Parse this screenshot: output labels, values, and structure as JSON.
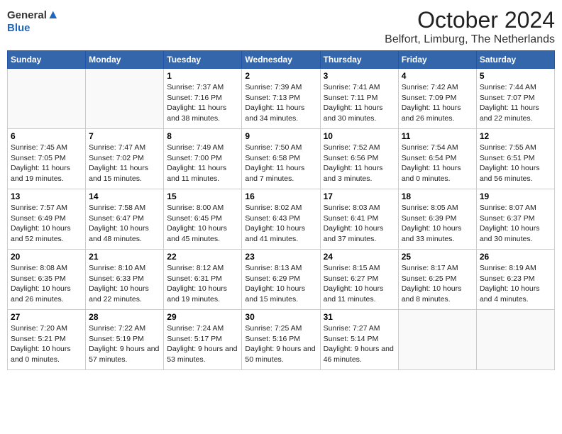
{
  "logo": {
    "general": "General",
    "blue": "Blue"
  },
  "title": "October 2024",
  "location": "Belfort, Limburg, The Netherlands",
  "weekdays": [
    "Sunday",
    "Monday",
    "Tuesday",
    "Wednesday",
    "Thursday",
    "Friday",
    "Saturday"
  ],
  "weeks": [
    [
      {
        "day": "",
        "sunrise": "",
        "sunset": "",
        "daylight": ""
      },
      {
        "day": "",
        "sunrise": "",
        "sunset": "",
        "daylight": ""
      },
      {
        "day": "1",
        "sunrise": "Sunrise: 7:37 AM",
        "sunset": "Sunset: 7:16 PM",
        "daylight": "Daylight: 11 hours and 38 minutes."
      },
      {
        "day": "2",
        "sunrise": "Sunrise: 7:39 AM",
        "sunset": "Sunset: 7:13 PM",
        "daylight": "Daylight: 11 hours and 34 minutes."
      },
      {
        "day": "3",
        "sunrise": "Sunrise: 7:41 AM",
        "sunset": "Sunset: 7:11 PM",
        "daylight": "Daylight: 11 hours and 30 minutes."
      },
      {
        "day": "4",
        "sunrise": "Sunrise: 7:42 AM",
        "sunset": "Sunset: 7:09 PM",
        "daylight": "Daylight: 11 hours and 26 minutes."
      },
      {
        "day": "5",
        "sunrise": "Sunrise: 7:44 AM",
        "sunset": "Sunset: 7:07 PM",
        "daylight": "Daylight: 11 hours and 22 minutes."
      }
    ],
    [
      {
        "day": "6",
        "sunrise": "Sunrise: 7:45 AM",
        "sunset": "Sunset: 7:05 PM",
        "daylight": "Daylight: 11 hours and 19 minutes."
      },
      {
        "day": "7",
        "sunrise": "Sunrise: 7:47 AM",
        "sunset": "Sunset: 7:02 PM",
        "daylight": "Daylight: 11 hours and 15 minutes."
      },
      {
        "day": "8",
        "sunrise": "Sunrise: 7:49 AM",
        "sunset": "Sunset: 7:00 PM",
        "daylight": "Daylight: 11 hours and 11 minutes."
      },
      {
        "day": "9",
        "sunrise": "Sunrise: 7:50 AM",
        "sunset": "Sunset: 6:58 PM",
        "daylight": "Daylight: 11 hours and 7 minutes."
      },
      {
        "day": "10",
        "sunrise": "Sunrise: 7:52 AM",
        "sunset": "Sunset: 6:56 PM",
        "daylight": "Daylight: 11 hours and 3 minutes."
      },
      {
        "day": "11",
        "sunrise": "Sunrise: 7:54 AM",
        "sunset": "Sunset: 6:54 PM",
        "daylight": "Daylight: 11 hours and 0 minutes."
      },
      {
        "day": "12",
        "sunrise": "Sunrise: 7:55 AM",
        "sunset": "Sunset: 6:51 PM",
        "daylight": "Daylight: 10 hours and 56 minutes."
      }
    ],
    [
      {
        "day": "13",
        "sunrise": "Sunrise: 7:57 AM",
        "sunset": "Sunset: 6:49 PM",
        "daylight": "Daylight: 10 hours and 52 minutes."
      },
      {
        "day": "14",
        "sunrise": "Sunrise: 7:58 AM",
        "sunset": "Sunset: 6:47 PM",
        "daylight": "Daylight: 10 hours and 48 minutes."
      },
      {
        "day": "15",
        "sunrise": "Sunrise: 8:00 AM",
        "sunset": "Sunset: 6:45 PM",
        "daylight": "Daylight: 10 hours and 45 minutes."
      },
      {
        "day": "16",
        "sunrise": "Sunrise: 8:02 AM",
        "sunset": "Sunset: 6:43 PM",
        "daylight": "Daylight: 10 hours and 41 minutes."
      },
      {
        "day": "17",
        "sunrise": "Sunrise: 8:03 AM",
        "sunset": "Sunset: 6:41 PM",
        "daylight": "Daylight: 10 hours and 37 minutes."
      },
      {
        "day": "18",
        "sunrise": "Sunrise: 8:05 AM",
        "sunset": "Sunset: 6:39 PM",
        "daylight": "Daylight: 10 hours and 33 minutes."
      },
      {
        "day": "19",
        "sunrise": "Sunrise: 8:07 AM",
        "sunset": "Sunset: 6:37 PM",
        "daylight": "Daylight: 10 hours and 30 minutes."
      }
    ],
    [
      {
        "day": "20",
        "sunrise": "Sunrise: 8:08 AM",
        "sunset": "Sunset: 6:35 PM",
        "daylight": "Daylight: 10 hours and 26 minutes."
      },
      {
        "day": "21",
        "sunrise": "Sunrise: 8:10 AM",
        "sunset": "Sunset: 6:33 PM",
        "daylight": "Daylight: 10 hours and 22 minutes."
      },
      {
        "day": "22",
        "sunrise": "Sunrise: 8:12 AM",
        "sunset": "Sunset: 6:31 PM",
        "daylight": "Daylight: 10 hours and 19 minutes."
      },
      {
        "day": "23",
        "sunrise": "Sunrise: 8:13 AM",
        "sunset": "Sunset: 6:29 PM",
        "daylight": "Daylight: 10 hours and 15 minutes."
      },
      {
        "day": "24",
        "sunrise": "Sunrise: 8:15 AM",
        "sunset": "Sunset: 6:27 PM",
        "daylight": "Daylight: 10 hours and 11 minutes."
      },
      {
        "day": "25",
        "sunrise": "Sunrise: 8:17 AM",
        "sunset": "Sunset: 6:25 PM",
        "daylight": "Daylight: 10 hours and 8 minutes."
      },
      {
        "day": "26",
        "sunrise": "Sunrise: 8:19 AM",
        "sunset": "Sunset: 6:23 PM",
        "daylight": "Daylight: 10 hours and 4 minutes."
      }
    ],
    [
      {
        "day": "27",
        "sunrise": "Sunrise: 7:20 AM",
        "sunset": "Sunset: 5:21 PM",
        "daylight": "Daylight: 10 hours and 0 minutes."
      },
      {
        "day": "28",
        "sunrise": "Sunrise: 7:22 AM",
        "sunset": "Sunset: 5:19 PM",
        "daylight": "Daylight: 9 hours and 57 minutes."
      },
      {
        "day": "29",
        "sunrise": "Sunrise: 7:24 AM",
        "sunset": "Sunset: 5:17 PM",
        "daylight": "Daylight: 9 hours and 53 minutes."
      },
      {
        "day": "30",
        "sunrise": "Sunrise: 7:25 AM",
        "sunset": "Sunset: 5:16 PM",
        "daylight": "Daylight: 9 hours and 50 minutes."
      },
      {
        "day": "31",
        "sunrise": "Sunrise: 7:27 AM",
        "sunset": "Sunset: 5:14 PM",
        "daylight": "Daylight: 9 hours and 46 minutes."
      },
      {
        "day": "",
        "sunrise": "",
        "sunset": "",
        "daylight": ""
      },
      {
        "day": "",
        "sunrise": "",
        "sunset": "",
        "daylight": ""
      }
    ]
  ]
}
